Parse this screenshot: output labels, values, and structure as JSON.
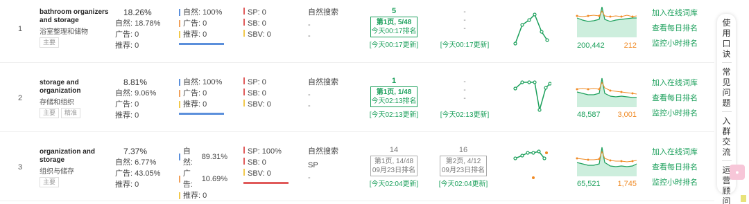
{
  "labels": {
    "natural": "自然:",
    "ad": "广告:",
    "recommend": "推荐:",
    "sp": "SP:",
    "sb": "SB:",
    "sbv": "SBV:",
    "natural_search": "自然搜索",
    "dash": "-"
  },
  "rows": [
    {
      "index": "1",
      "keyword_en": "bathroom organizers and storage",
      "keyword_cn": "浴室整理和储物",
      "tags": [
        "主要"
      ],
      "share_total": "18.26%",
      "natural": "18.78%",
      "ad": "0",
      "recommend": "0",
      "bar_natural": "100%",
      "bar_ad": "0",
      "bar_recommend": "0",
      "bar_fill": {
        "natural": 1.0,
        "ad": 0.0,
        "recommend": 0.0
      },
      "sp": "0",
      "sb": "0",
      "sbv": "0",
      "sp_fill": 0,
      "nat_search_items": [
        "-",
        "-"
      ],
      "rank_num": "5",
      "rank_box_page": "第1页, 5/48",
      "rank_box_time": "今天00:17排名",
      "rank_update": "[今天00:17更新]",
      "rank2_num": "-",
      "rank2_items": [
        "-",
        "-"
      ],
      "rank2_update": "[今天00:17更新]",
      "area_left": "200,442",
      "area_right": "212"
    },
    {
      "index": "2",
      "keyword_en": "storage and organization",
      "keyword_cn": "存储和组织",
      "tags": [
        "主要",
        "精准"
      ],
      "share_total": "8.81%",
      "natural": "9.06%",
      "ad": "0",
      "recommend": "0",
      "bar_natural": "100%",
      "bar_ad": "0",
      "bar_recommend": "0",
      "bar_fill": {
        "natural": 1.0,
        "ad": 0.0,
        "recommend": 0.0
      },
      "sp": "0",
      "sb": "0",
      "sbv": "0",
      "sp_fill": 0,
      "nat_search_items": [
        "-",
        "-"
      ],
      "rank_num": "1",
      "rank_box_page": "第1页, 1/48",
      "rank_box_time": "今天02:13排名",
      "rank_update": "[今天02:13更新]",
      "rank2_num": "-",
      "rank2_items": [
        "-",
        "-"
      ],
      "rank2_update": "[今天02:13更新]",
      "area_left": "48,587",
      "area_right": "3,001"
    },
    {
      "index": "3",
      "keyword_en": "organization and storage",
      "keyword_cn": "组织与储存",
      "tags": [
        "主要"
      ],
      "share_total": "7.37%",
      "natural": "6.77%",
      "ad": "43.05%",
      "recommend": "0",
      "bar_natural": "89.31%",
      "bar_ad": "10.69%",
      "bar_recommend": "0",
      "bar_fill": {
        "natural": 0.8931,
        "ad": 0.1069,
        "recommend": 0.0
      },
      "sp": "100%",
      "sb": "0",
      "sbv": "0",
      "sp_fill": 1,
      "nat_search_items": [
        "SP",
        "-"
      ],
      "rank_num": "14",
      "rank_box_page": "第1页, 14/48",
      "rank_box_time": "09月23日排名",
      "rank_update": "[今天02:04更新]",
      "rank2_num": "16",
      "rank2_items": [
        "第2页, 4/12",
        "09月23日排名"
      ],
      "rank2_update": "[今天02:04更新]",
      "area_left": "65,521",
      "area_right": "1,745"
    }
  ],
  "links": {
    "add_lexicon": "加入在线词库",
    "daily_rank": "查看每日排名",
    "hourly_rank": "监控小时排名"
  },
  "sidebar": {
    "groups": [
      "使用口诀",
      "常见问题",
      "入群交流",
      "运营顾问"
    ]
  },
  "colors": {
    "green": "#1a9f5a",
    "orange": "#f08a24",
    "blue": "#5b8fdb",
    "red": "#e05a5a"
  }
}
